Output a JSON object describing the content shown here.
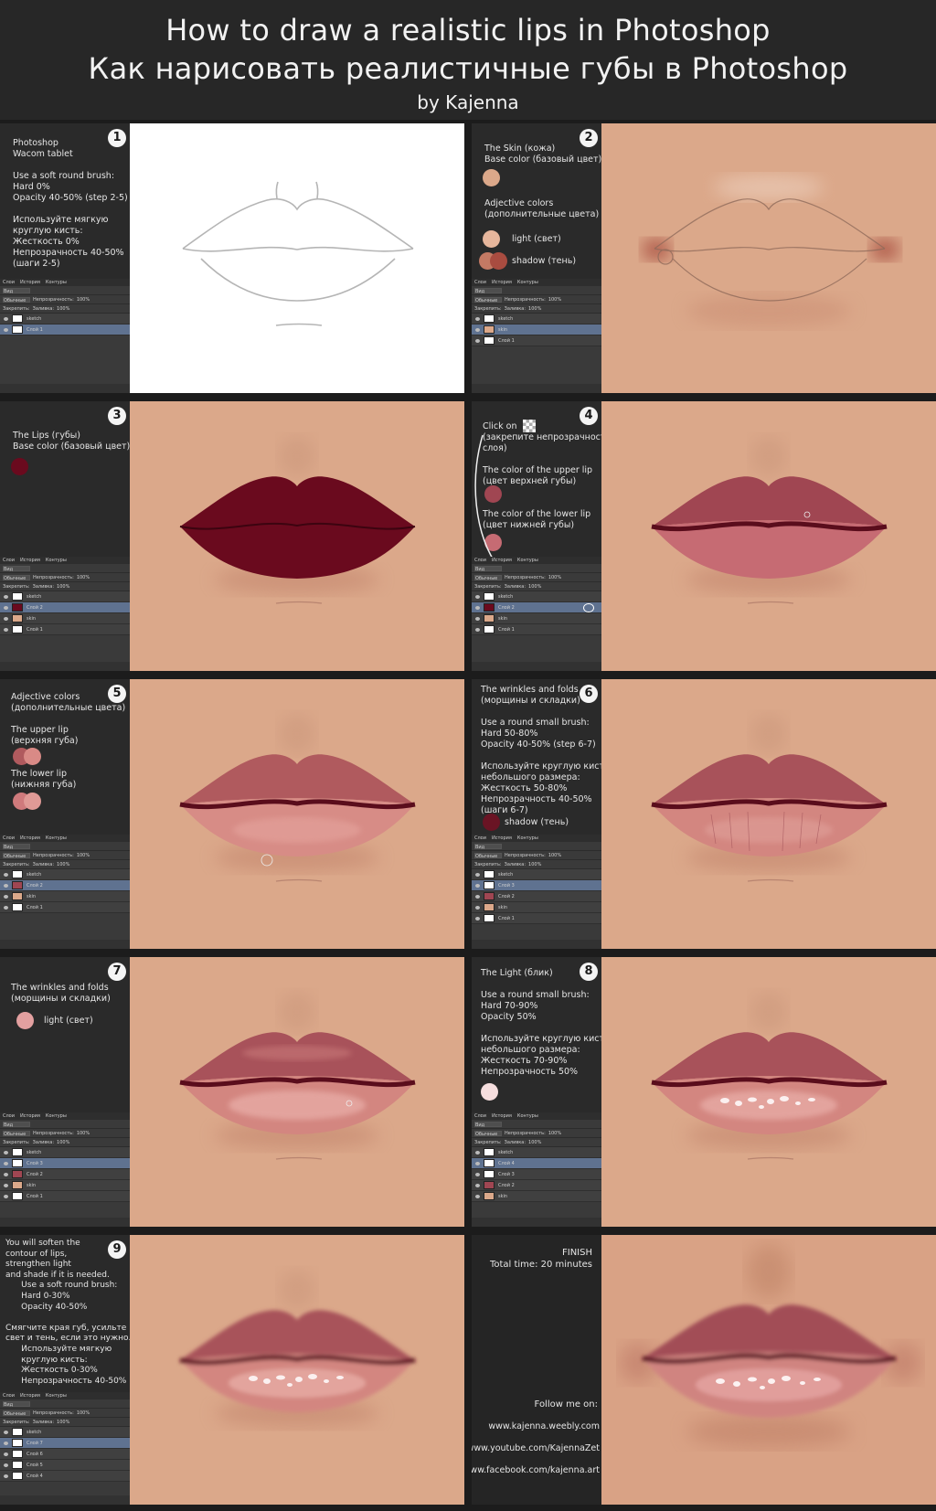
{
  "header": {
    "title_en": "How to draw a realistic lips in Photoshop",
    "title_ru": "Как нарисовать реалистичные губы в Photoshop",
    "byline": "by Kajenna"
  },
  "colors": {
    "skin": "#dba88a",
    "lip_base": "#6a0a1e",
    "upper_lip": "#a04652",
    "lower_lip": "#c66b73",
    "light": "#e3a0a0",
    "shadow": "#6a1424",
    "highlight": "#f6dede"
  },
  "panel": {
    "tab1": "Слои",
    "tab2": "История",
    "tab3": "Контуры",
    "kind": "Вид",
    "mode": "Обычные",
    "opacity_label": "Непрозрачность:",
    "opacity_value": "100%",
    "lock_label": "Закрепить:",
    "fill_label": "Заливка:",
    "fill_value": "100%"
  },
  "steps": [
    {
      "num": "1",
      "text": "Photoshop\nWacom tablet\n\nUse a soft round brush:\nHard 0%\nOpacity 40-50% (step 2-5)\n\nИспользуйте мягкую\nкруглую кисть:\nЖесткость 0%\nНепрозрачность 40-50%\n(шаги 2-5)",
      "layers": [
        "sketch",
        "Слой 1"
      ]
    },
    {
      "num": "2",
      "text": "The Skin (кожа)\nBase color (базовый цвет)\n\n\n\nAdjective colors\n(дополнительные цвета)",
      "light_label": "light (свет)",
      "shadow_label": "shadow (тень)",
      "layers": [
        "sketch",
        "skin",
        "Слой 1"
      ]
    },
    {
      "num": "3",
      "text": "The Lips (губы)\nBase color (базовый цвет)",
      "layers": [
        "sketch",
        "Слой 2",
        "skin",
        "Слой 1"
      ]
    },
    {
      "num": "4",
      "text": "Click on\n(закрепите непрозрачность\nслоя)\n\nThe color of the upper lip\n(цвет верхней губы)\n\n\nThe color of the lower lip\n(цвет нижней губы)",
      "layers": [
        "sketch",
        "Слой 2",
        "skin",
        "Слой 1"
      ]
    },
    {
      "num": "5",
      "text": "Adjective colors\n(дополнительные цвета)\n\nThe upper lip\n(верхняя губа)\n\n\nThe lower lip\n(нижняя губа)",
      "layers": [
        "sketch",
        "Слой 2",
        "skin",
        "Слой 1"
      ]
    },
    {
      "num": "6",
      "text": "The wrinkles and folds\n(морщины и складки)\n\nUse a round small brush:\nHard 50-80%\nOpacity 40-50% (step 6-7)\n\nИспользуйте круглую кисть\nнебольшого размера:\nЖесткость 50-80%\nНепрозрачность 40-50%\n(шаги 6-7)",
      "shadow_label": "shadow (тень)",
      "layers": [
        "sketch",
        "Слой 3",
        "Слой 2",
        "skin",
        "Слой 1"
      ]
    },
    {
      "num": "7",
      "text": "The wrinkles and folds\n(морщины и складки)",
      "light_label": "light (свет)",
      "layers": [
        "sketch",
        "Слой 3",
        "Слой 2",
        "skin",
        "Слой 1"
      ]
    },
    {
      "num": "8",
      "text": "The Light (блик)\n\nUse a round small brush:\nHard 70-90%\nOpacity 50%\n\nИспользуйте круглую кисть\nнебольшого размера:\nЖесткость 70-90%\nНепрозрачность 50%",
      "layers": [
        "sketch",
        "Слой 4",
        "Слой 3",
        "Слой 2",
        "skin"
      ]
    },
    {
      "num": "9",
      "text": "You will soften the\ncontour of lips,\nstrengthen light\nand shade if it is needed.\n      Use a soft round brush:\n      Hard 0-30%\n      Opacity 40-50%\n\nСмягчите края губ, усильте\nсвет и тень, если это нужно.\n      Используйте мягкую\n      круглую кисть:\n      Жесткость 0-30%\n      Непрозрачность 40-50%",
      "layers": [
        "sketch",
        "Слой 7",
        "Слой 6",
        "Слой 5",
        "Слой 4"
      ]
    }
  ],
  "finish": {
    "title": "FINISH",
    "time": "Total time: 20 minutes",
    "follow": "Follow me on:",
    "link1": "www.kajenna.weebly.com",
    "link2": "www.youtube.com/KajennaZet",
    "link3": "www.facebook.com/kajenna.art"
  }
}
